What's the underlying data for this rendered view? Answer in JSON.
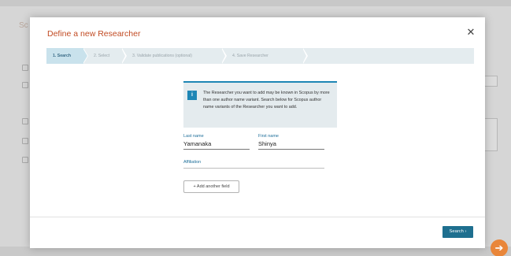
{
  "modal": {
    "title": "Define a new Researcher",
    "close_icon": "close-icon"
  },
  "steps": [
    {
      "label": "1. Search",
      "active": true
    },
    {
      "label": "2. Select",
      "active": false
    },
    {
      "label": "3. Validate publications (optional)",
      "active": false
    },
    {
      "label": "4. Save Researcher",
      "active": false
    }
  ],
  "info": {
    "icon": "i",
    "text": "The Researcher you want to add may be known in Scopus by more than one author name variant. Search below for Scopus author name variants of the Researcher you want to add."
  },
  "fields": {
    "last_name": {
      "label": "Last name",
      "value": "Yamanaka"
    },
    "first_name": {
      "label": "First name",
      "value": "Shinya"
    },
    "affiliation": {
      "label": "Affiliation",
      "value": ""
    }
  },
  "add_field_label": "+ Add another field",
  "search_button_label": "Search  ›",
  "background": {
    "corner_label": "Sc",
    "orange_button_icon": "arrow-circle-icon"
  },
  "colors": {
    "accent_title": "#c14a22",
    "primary": "#1e6f8f",
    "stepper_bg": "#e4ecef",
    "info_bg": "#e4ebee"
  }
}
